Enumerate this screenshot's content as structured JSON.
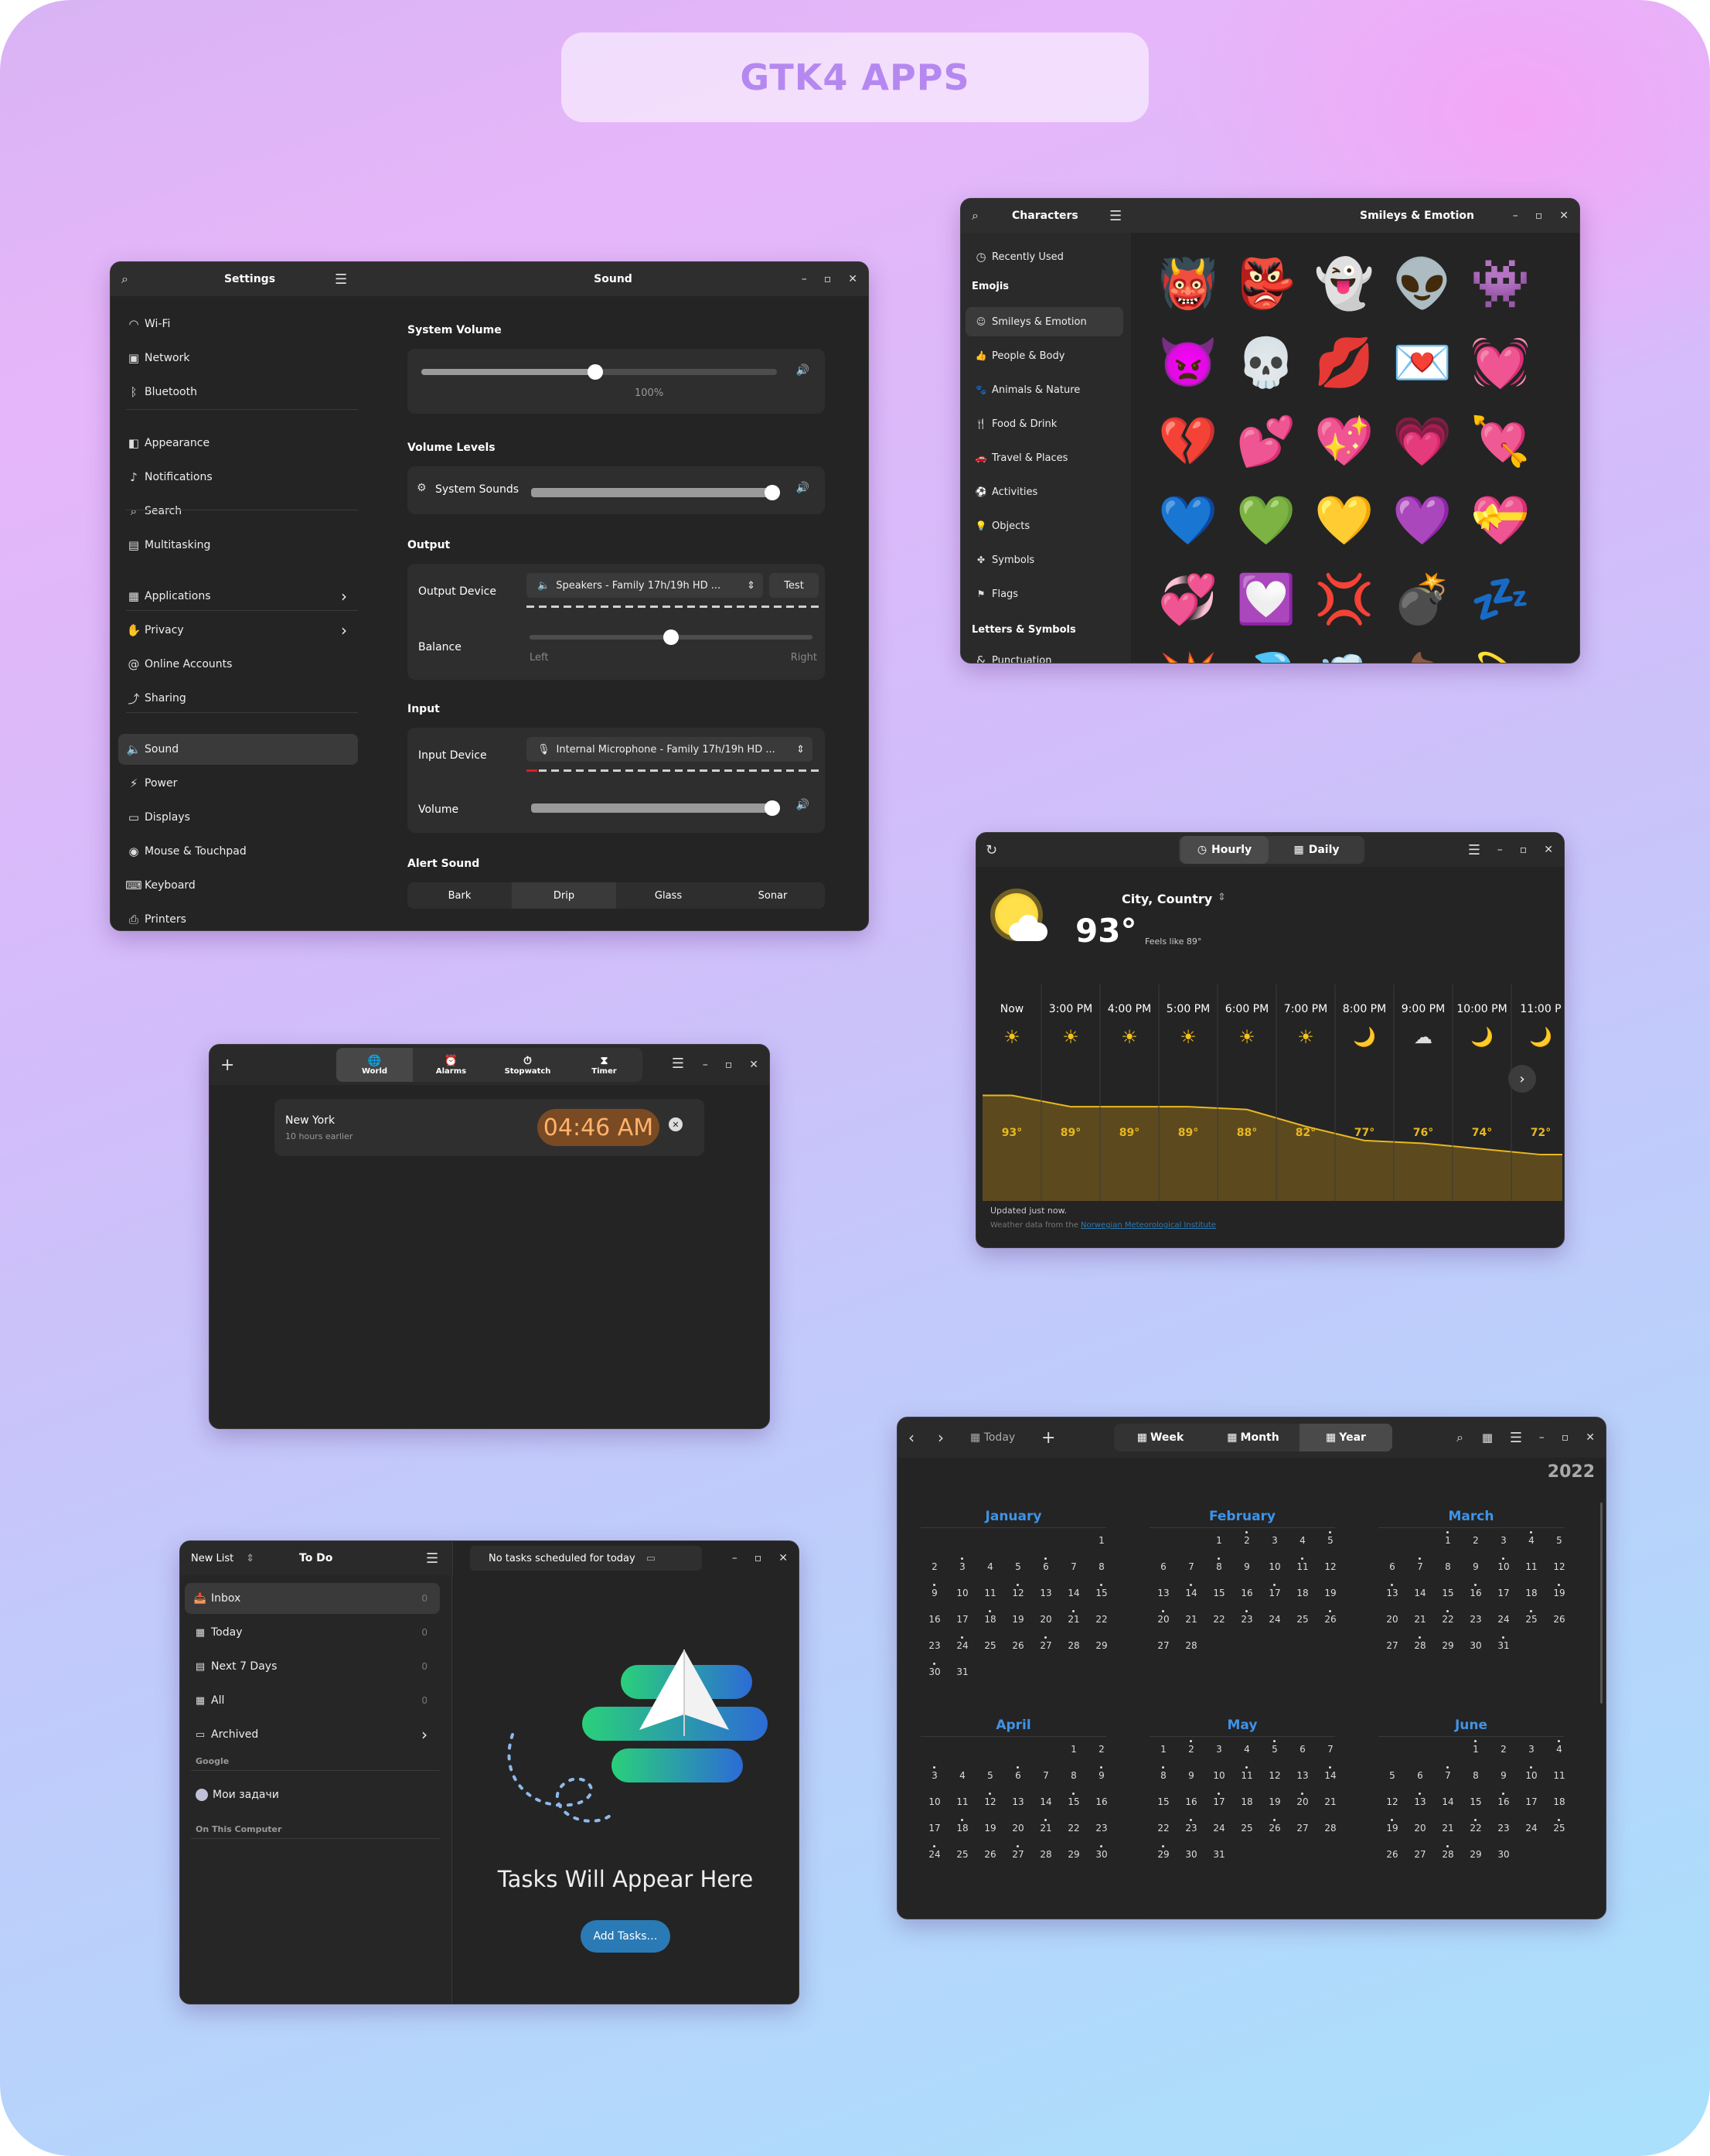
{
  "page": {
    "title": "GTK4 APPS"
  },
  "settings": {
    "sidebar_title": "Settings",
    "page_title": "Sound",
    "items": [
      {
        "label": "Wi-Fi",
        "icon": "wifi-icon"
      },
      {
        "label": "Network",
        "icon": "network-icon"
      },
      {
        "label": "Bluetooth",
        "icon": "bluetooth-icon"
      },
      {
        "label": "Appearance",
        "icon": "appearance-icon"
      },
      {
        "label": "Notifications",
        "icon": "bell-icon"
      },
      {
        "label": "Search",
        "icon": "search-icon"
      },
      {
        "label": "Multitasking",
        "icon": "multitasking-icon"
      },
      {
        "label": "Applications",
        "icon": "apps-icon"
      },
      {
        "label": "Privacy",
        "icon": "hand-icon"
      },
      {
        "label": "Online Accounts",
        "icon": "at-icon"
      },
      {
        "label": "Sharing",
        "icon": "share-icon"
      },
      {
        "label": "Sound",
        "icon": "speaker-icon"
      },
      {
        "label": "Power",
        "icon": "power-icon"
      },
      {
        "label": "Displays",
        "icon": "display-icon"
      },
      {
        "label": "Mouse & Touchpad",
        "icon": "mouse-icon"
      },
      {
        "label": "Keyboard",
        "icon": "keyboard-icon"
      },
      {
        "label": "Printers",
        "icon": "printer-icon"
      }
    ],
    "system_volume": {
      "label": "System Volume",
      "value_label": "100%",
      "level": 0.49
    },
    "volume_levels": {
      "label": "Volume Levels",
      "system_sounds": "System Sounds",
      "level": 0.98
    },
    "output": {
      "label": "Output",
      "device_label": "Output Device",
      "device": "Speakers - Family 17h/19h HD ...",
      "test": "Test",
      "balance_label": "Balance",
      "left": "Left",
      "right": "Right",
      "balance": 0.5
    },
    "input": {
      "label": "Input",
      "device_label": "Input Device",
      "device": "Internal Microphone - Family 17h/19h HD ...",
      "volume_label": "Volume",
      "level": 0.98
    },
    "alert": {
      "label": "Alert Sound",
      "options": [
        "Bark",
        "Drip",
        "Glass",
        "Sonar"
      ],
      "selected": "Drip"
    }
  },
  "characters": {
    "title": "Characters",
    "page_title": "Smileys & Emotion",
    "recently_used": "Recently Used",
    "emojis_header": "Emojis",
    "letters_header": "Letters & Symbols",
    "categories": [
      {
        "label": "Smileys & Emotion",
        "icon": "smiley-icon"
      },
      {
        "label": "People & Body",
        "icon": "thumbs-up-icon"
      },
      {
        "label": "Animals & Nature",
        "icon": "paw-icon"
      },
      {
        "label": "Food & Drink",
        "icon": "fork-knife-icon"
      },
      {
        "label": "Travel & Places",
        "icon": "car-icon"
      },
      {
        "label": "Activities",
        "icon": "ball-icon"
      },
      {
        "label": "Objects",
        "icon": "bulb-icon"
      },
      {
        "label": "Symbols",
        "icon": "symbols-icon"
      },
      {
        "label": "Flags",
        "icon": "flag-icon"
      }
    ],
    "punctuation": "Punctuation",
    "emojis": [
      "👹",
      "👺",
      "👻",
      "👽",
      "👾",
      "👿",
      "💀",
      "💋",
      "💌",
      "💓",
      "💔",
      "💕",
      "💖",
      "💗",
      "💘",
      "💙",
      "💚",
      "💛",
      "💜",
      "💝",
      "💞",
      "💟",
      "💢",
      "💣",
      "💤",
      "💥",
      "💦",
      "💨",
      "💩",
      "💫"
    ]
  },
  "weather": {
    "tabs": [
      "Hourly",
      "Daily"
    ],
    "location": "City, Country",
    "temp": "93°",
    "feels": "Feels like 89°",
    "hours": [
      "Now",
      "3:00 PM",
      "4:00 PM",
      "5:00 PM",
      "6:00 PM",
      "7:00 PM",
      "8:00 PM",
      "9:00 PM",
      "10:00 PM",
      "11:00 P"
    ],
    "icons": [
      "☀",
      "☀",
      "☀",
      "☀",
      "☀",
      "☀",
      "🌙",
      "☁",
      "🌙",
      "🌙"
    ],
    "temps": [
      "93°",
      "89°",
      "89°",
      "89°",
      "88°",
      "82°",
      "77°",
      "76°",
      "74°",
      "72°"
    ],
    "temp_values": [
      93,
      89,
      89,
      89,
      88,
      82,
      77,
      76,
      74,
      72
    ],
    "updated": "Updated just now.",
    "source_prefix": "Weather data from the ",
    "source_link": "Norwegian Meteorological Institute"
  },
  "clocks": {
    "tabs": [
      {
        "label": "World",
        "icon": "globe-icon"
      },
      {
        "label": "Alarms",
        "icon": "alarm-icon"
      },
      {
        "label": "Stopwatch",
        "icon": "stopwatch-icon"
      },
      {
        "label": "Timer",
        "icon": "hourglass-icon"
      }
    ],
    "city": "New York",
    "offset": "10 hours earlier",
    "time": "04:46 AM"
  },
  "calendar": {
    "today": "Today",
    "views": [
      "Week",
      "Month",
      "Year"
    ],
    "year": "2022",
    "months": [
      {
        "name": "January",
        "start": 6,
        "days": 31
      },
      {
        "name": "February",
        "start": 2,
        "days": 28
      },
      {
        "name": "March",
        "start": 2,
        "days": 31
      },
      {
        "name": "April",
        "start": 5,
        "days": 30
      },
      {
        "name": "May",
        "start": 0,
        "days": 31
      },
      {
        "name": "June",
        "start": 3,
        "days": 30
      }
    ]
  },
  "todo": {
    "new_list": "New List",
    "title": "To Do",
    "status": "No tasks scheduled for today",
    "lists": [
      {
        "label": "Inbox",
        "count": "0",
        "icon": "inbox-icon"
      },
      {
        "label": "Today",
        "count": "0",
        "icon": "calendar-icon"
      },
      {
        "label": "Next 7 Days",
        "count": "0",
        "icon": "week-icon"
      },
      {
        "label": "All",
        "count": "0",
        "icon": "grid-icon"
      },
      {
        "label": "Archived",
        "count": "",
        "icon": "folder-icon"
      }
    ],
    "google": "Google",
    "google_list": "Мои задачи",
    "local": "On This Computer",
    "empty_title": "Tasks Will Appear Here",
    "add_button": "Add Tasks…"
  }
}
